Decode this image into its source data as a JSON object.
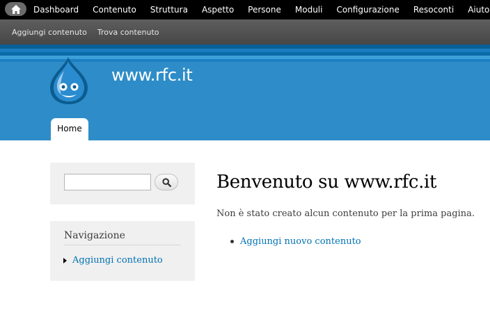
{
  "toolbar": {
    "home_icon": "home-icon",
    "menu": [
      {
        "label": "Dashboard"
      },
      {
        "label": "Contenuto"
      },
      {
        "label": "Struttura"
      },
      {
        "label": "Aspetto"
      },
      {
        "label": "Persone"
      },
      {
        "label": "Moduli"
      },
      {
        "label": "Configurazione"
      },
      {
        "label": "Resoconti"
      },
      {
        "label": "Aiuto"
      }
    ]
  },
  "shortcuts": [
    {
      "label": "Aggiungi contenuto"
    },
    {
      "label": "Trova contenuto"
    }
  ],
  "header": {
    "site_name": "www.rfc.it",
    "logo_icon": "drupal-drop-icon",
    "tabs": [
      {
        "label": "Home",
        "active": true
      }
    ]
  },
  "sidebar": {
    "search": {
      "input_value": "",
      "button_icon": "search-icon"
    },
    "navigation": {
      "title": "Navigazione",
      "items": [
        {
          "label": "Aggiungi contenuto"
        }
      ]
    }
  },
  "content": {
    "title": "Benvenuto su www.rfc.it",
    "intro": "Non è stato creato alcun contenuto per la prima pagina.",
    "actions": [
      {
        "label": "Aggiungi nuovo contenuto"
      }
    ]
  },
  "colors": {
    "toolbar": "#000000",
    "shortcuts": "#505050",
    "header": "#2e8dc8",
    "link": "#0071b3",
    "sidebar_block": "#f0f0f0"
  }
}
